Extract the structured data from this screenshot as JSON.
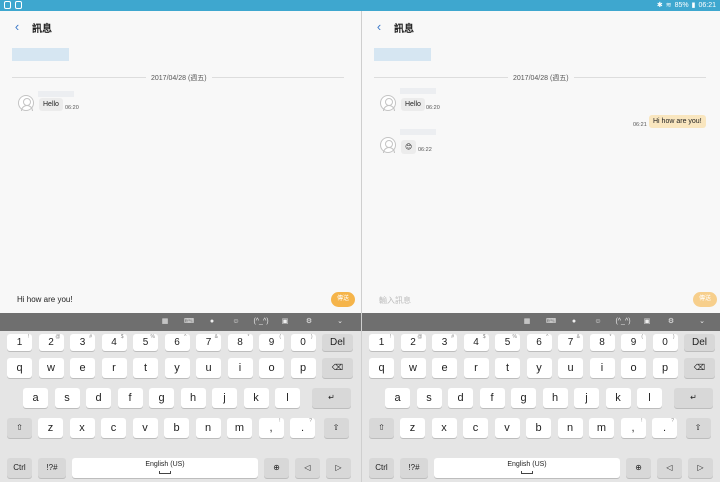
{
  "status": {
    "battery": "85%",
    "time": "06:21"
  },
  "left": {
    "title": "訊息",
    "date": "2017/04/28 (週五)",
    "messages": [
      {
        "text": "Hello",
        "time": "06:20"
      }
    ],
    "input_text": "Hi how are you!",
    "send_label": "傳送"
  },
  "right": {
    "title": "訊息",
    "date": "2017/04/28 (週五)",
    "messages": [
      {
        "text": "Hello",
        "time": "06:20"
      },
      {
        "text": "Hi how are you!",
        "time": "06:21"
      },
      {
        "text": "😊",
        "time": "06:22"
      }
    ],
    "input_placeholder": "輸入訊息",
    "send_label": "傳送"
  },
  "keyboard": {
    "toolbar_icons": [
      "clipboard-icon",
      "keyboard-icon",
      "mic-icon",
      "emoji-icon",
      "kaomoji-icon",
      "sticker-icon",
      "settings-icon",
      "collapse-icon"
    ],
    "kaomoji_label": "(^_^)",
    "numbers": [
      {
        "k": "1",
        "s": "!"
      },
      {
        "k": "2",
        "s": "@"
      },
      {
        "k": "3",
        "s": "#"
      },
      {
        "k": "4",
        "s": "$"
      },
      {
        "k": "5",
        "s": "%"
      },
      {
        "k": "6",
        "s": "^"
      },
      {
        "k": "7",
        "s": "&"
      },
      {
        "k": "8",
        "s": "*"
      },
      {
        "k": "9",
        "s": "("
      },
      {
        "k": "0",
        "s": ")"
      }
    ],
    "del_label": "Del",
    "row1": [
      "q",
      "w",
      "e",
      "r",
      "t",
      "y",
      "u",
      "i",
      "o",
      "p"
    ],
    "row2": [
      "a",
      "s",
      "d",
      "f",
      "g",
      "h",
      "j",
      "k",
      "l"
    ],
    "row3": [
      "z",
      "x",
      "c",
      "v",
      "b",
      "n",
      "m"
    ],
    "comma": ",",
    "comma_sup": "!",
    "period": ".",
    "period_sup": "?",
    "ctrl_label": "Ctrl",
    "sym_label": "!?#",
    "space_label": "English (US)"
  }
}
